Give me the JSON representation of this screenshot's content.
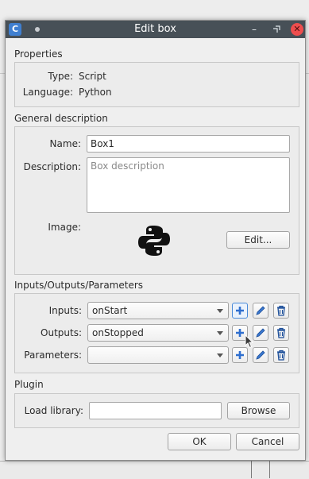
{
  "dialog": {
    "title": "Edit box",
    "app_icon_letter": "C"
  },
  "properties": {
    "section_label": "Properties",
    "type_label": "Type:",
    "type_value": "Script",
    "language_label": "Language:",
    "language_value": "Python"
  },
  "general": {
    "section_label": "General description",
    "name_label": "Name:",
    "name_value": "Box1",
    "description_label": "Description:",
    "description_placeholder": "Box description",
    "image_label": "Image:",
    "edit_button": "Edit..."
  },
  "io": {
    "section_label": "Inputs/Outputs/Parameters",
    "rows": [
      {
        "label": "Inputs:",
        "value": "onStart"
      },
      {
        "label": "Outputs:",
        "value": "onStopped"
      },
      {
        "label": "Parameters:",
        "value": ""
      }
    ]
  },
  "plugin": {
    "section_label": "Plugin",
    "load_label": "Load library:",
    "load_value": "",
    "browse_button": "Browse"
  },
  "footer": {
    "ok_button": "OK",
    "cancel_button": "Cancel"
  },
  "colors": {
    "titlebar": "#475057",
    "add_icon": "#2f6fcf",
    "close_button": "#ee4e4e"
  }
}
